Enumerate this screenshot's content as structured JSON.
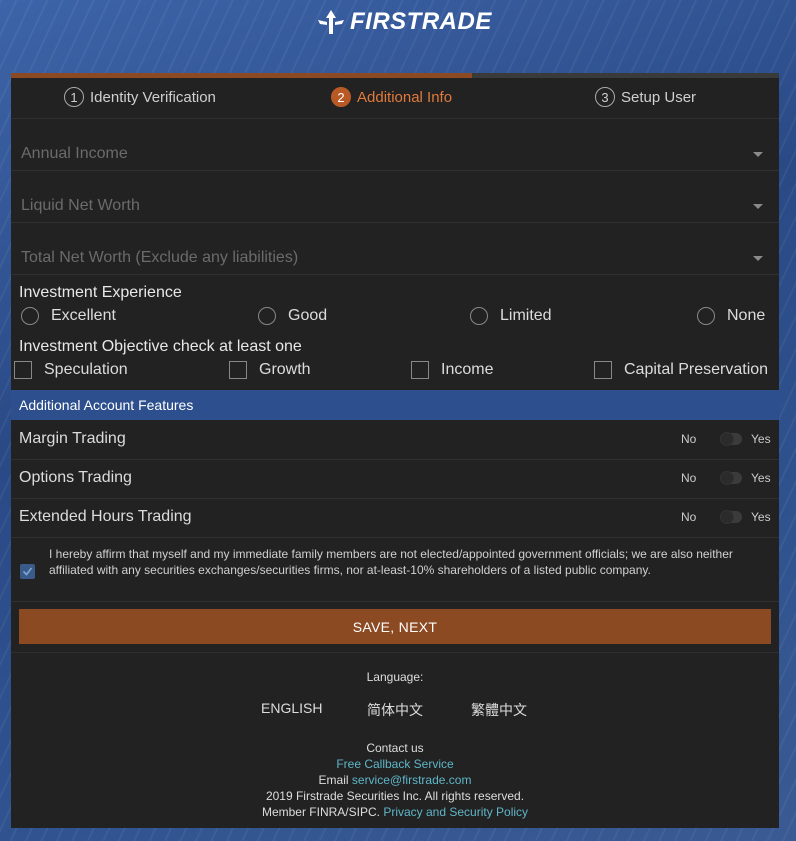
{
  "brand": {
    "name": "FIRSTRADE"
  },
  "steps": [
    {
      "num": "1",
      "label": "Identity Verification",
      "active": false
    },
    {
      "num": "2",
      "label": "Additional Info",
      "active": true
    },
    {
      "num": "3",
      "label": "Setup User",
      "active": false
    }
  ],
  "progress": {
    "fraction": 0.6,
    "color": "#8c4a22"
  },
  "selects": [
    {
      "placeholder": "Annual Income"
    },
    {
      "placeholder": "Liquid Net Worth"
    },
    {
      "placeholder": "Total Net Worth (Exclude any liabilities)"
    }
  ],
  "experience": {
    "label": "Investment Experience",
    "options": [
      "Excellent",
      "Good",
      "Limited",
      "None"
    ]
  },
  "objective": {
    "label": "Investment Objective check at least one",
    "options": [
      "Speculation",
      "Growth",
      "Income",
      "Capital Preservation"
    ]
  },
  "features": {
    "title": "Additional Account Features",
    "toggles": [
      {
        "label": "Margin Trading",
        "no": "No",
        "yes": "Yes"
      },
      {
        "label": "Options Trading",
        "no": "No",
        "yes": "Yes"
      },
      {
        "label": "Extended Hours Trading",
        "no": "No",
        "yes": "Yes"
      }
    ]
  },
  "affirmation": {
    "checked": true,
    "text": "I hereby affirm that myself and my immediate family members are not elected/appointed government officials; we are also neither affiliated with any securities exchanges/securities firms, nor at-least-10% shareholders of a listed public company."
  },
  "save_button": "SAVE, NEXT",
  "language": {
    "label": "Language:",
    "options": [
      "ENGLISH",
      "简体中文",
      "繁體中文"
    ]
  },
  "footer": {
    "contact": "Contact us",
    "callback": "Free Callback Service",
    "email_label": "Email ",
    "email": "service@firstrade.com",
    "copyright": "2019 Firstrade Securities Inc. All rights reserved.",
    "member": "Member FINRA/SIPC. ",
    "privacy": "Privacy and Security Policy"
  },
  "colors": {
    "accent": "#b95a26",
    "button": "#8c4a22",
    "link": "#5fb6c8",
    "card": "#222222",
    "bar": "#2d4f8e"
  }
}
